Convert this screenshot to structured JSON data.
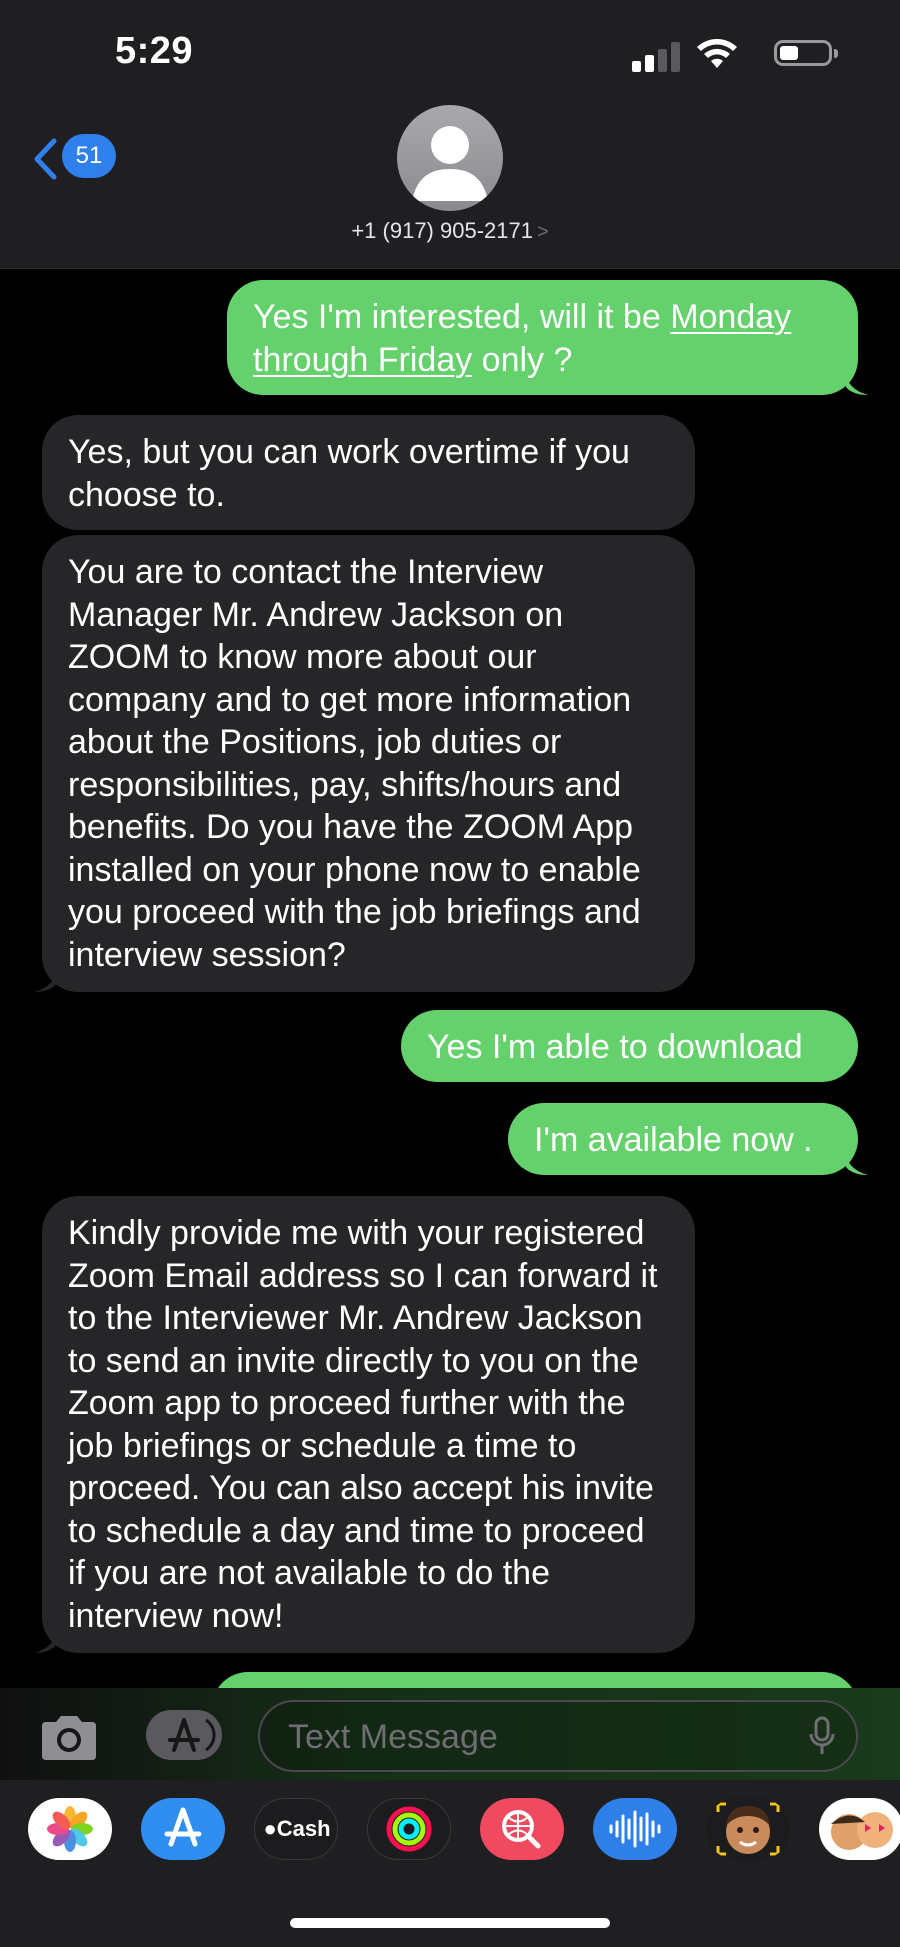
{
  "status_bar": {
    "time": "5:29"
  },
  "header": {
    "back_badge": "51",
    "contact_number": "+1 (917) 905-2171",
    "chevron": ">"
  },
  "messages": [
    {
      "type": "sent",
      "parts": [
        "Yes I'm interested, will it be ",
        "Monday",
        "through Friday",
        " only ?"
      ]
    },
    {
      "type": "received",
      "text": "Yes, but you can work overtime if you choose to."
    },
    {
      "type": "received",
      "text": "You are to contact the Interview Manager Mr. Andrew Jackson on ZOOM to know more about our company and to get more information about the Positions, job duties or responsibilities, pay, shifts/hours and benefits. Do you have the ZOOM App installed on your phone now to enable you proceed with the job briefings and interview session?"
    },
    {
      "type": "sent",
      "text": "Yes I'm able to download"
    },
    {
      "type": "sent",
      "text": "I'm available now ."
    },
    {
      "type": "received",
      "text": "Kindly provide me with your registered Zoom Email address so I can forward it to the Interviewer Mr. Andrew Jackson to send an invite directly to you on the Zoom app to proceed further with the job briefings or schedule a time to proceed. You can also accept his invite to schedule a day and time to proceed if you are not available to do the interview now!"
    }
  ],
  "composer": {
    "placeholder": "Text Message"
  },
  "app_drawer": {
    "apps": [
      {
        "name": "Photos",
        "icon": "photos-icon"
      },
      {
        "name": "App Store",
        "icon": "app-store-icon"
      },
      {
        "name": "Apple Cash",
        "icon": "apple-cash-icon",
        "label": "Cash"
      },
      {
        "name": "Activity",
        "icon": "activity-rings-icon"
      },
      {
        "name": "Search Images",
        "icon": "image-search-icon"
      },
      {
        "name": "Audio Message",
        "icon": "audio-waveform-icon"
      },
      {
        "name": "Memoji",
        "icon": "memoji-icon"
      },
      {
        "name": "Memoji Stickers",
        "icon": "memoji-stickers-icon"
      }
    ]
  },
  "colors": {
    "sent_bubble": "#65d16c",
    "received_bubble": "#262628",
    "accent": "#2f80ed"
  }
}
